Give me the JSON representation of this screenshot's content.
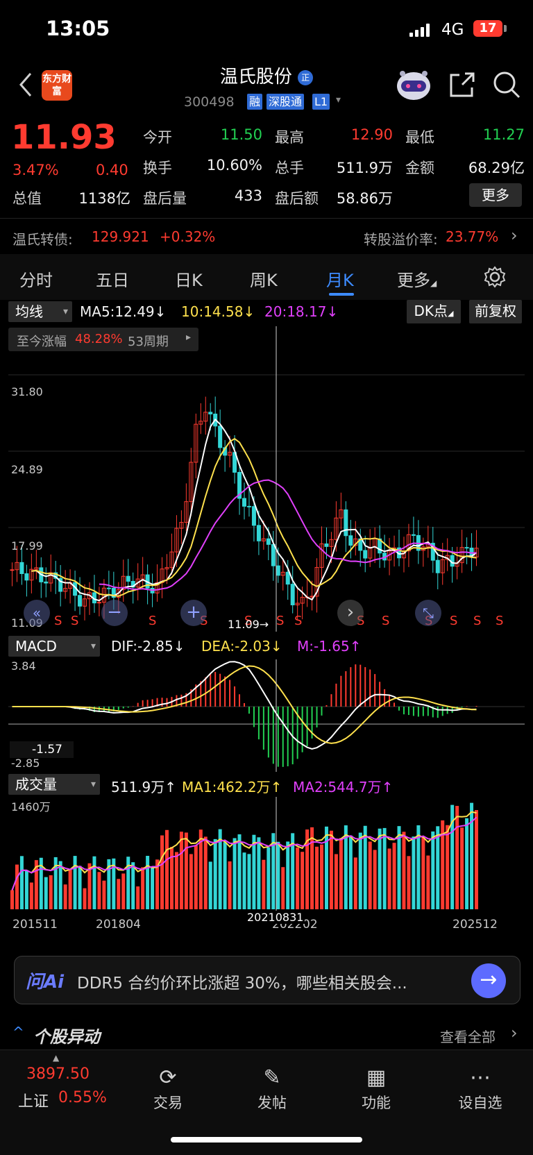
{
  "status_bar": {
    "time": "13:05",
    "network": "4G",
    "battery": "17"
  },
  "header": {
    "logo_text": "东方财富",
    "title": "温氏股份",
    "badge": "正",
    "code": "300498",
    "tags": [
      "融",
      "深股通",
      "L1"
    ]
  },
  "quote": {
    "price": "11.93",
    "change_pct": "3.47%",
    "change": "0.40",
    "open_label": "今开",
    "open": "11.50",
    "high_label": "最高",
    "high": "12.90",
    "low_label": "最低",
    "low": "11.27",
    "turnover_label": "换手",
    "turnover": "10.60%",
    "volume_label": "总手",
    "volume": "511.9万",
    "amount_label": "金额",
    "amount": "68.29亿",
    "mktcap_label": "总值",
    "mktcap": "1138亿",
    "after_vol_label": "盘后量",
    "after_vol": "433",
    "after_amt_label": "盘后额",
    "after_amt": "58.86万",
    "more": "更多"
  },
  "convertible": {
    "label": "温氏转债:",
    "price": "129.921",
    "change": "+0.32%",
    "premium_label": "转股溢价率:",
    "premium": "23.77%"
  },
  "tabs": [
    "分时",
    "五日",
    "日K",
    "周K",
    "月K",
    "更多"
  ],
  "active_tab": "月K",
  "ma_bar": {
    "select": "均线",
    "ma5": "MA5:12.49↓",
    "ma10": "10:14.58↓",
    "ma20": "20:18.17↓",
    "dk": "DK点",
    "adjust": "前复权"
  },
  "period_info": {
    "label": "至今涨幅",
    "pct": "48.28%",
    "periods": "53周期"
  },
  "kline": {
    "y_labels": [
      "31.80",
      "24.89",
      "17.99",
      "11.09"
    ],
    "cursor_label": "11.09→",
    "ma_colors": {
      "ma5": "#ffffff",
      "ma10": "#ffe14d",
      "ma20": "#e040fb"
    },
    "up_color": "#ff3b30",
    "down_color": "#33d6d6"
  },
  "macd": {
    "select": "MACD",
    "dif": "DIF:-2.85↓",
    "dea": "DEA:-2.03↓",
    "m": "M:-1.65↑",
    "y_top": "3.84",
    "y_cursor": "-1.57",
    "y_bottom": "-2.85"
  },
  "volume": {
    "select": "成交量",
    "value": "511.9万↑",
    "ma1": "MA1:462.2万↑",
    "ma2": "MA2:544.7万↑",
    "y_top": "1460万"
  },
  "x_labels": {
    "a": "201511",
    "b": "201804",
    "c": "2022",
    "c2": "02",
    "d": "202512",
    "cursor": "20210831"
  },
  "ai": {
    "logo": "问Ai",
    "text": "DDR5 合约价环比涨超 30%，哪些相关股会..."
  },
  "anomaly": {
    "title": "个股异动",
    "view_all": "查看全部"
  },
  "bottom_nav": {
    "index_value": "3897.50",
    "index_name": "上证",
    "index_change": "0.55%",
    "items": [
      "交易",
      "发帖",
      "功能",
      "设自选"
    ]
  }
}
